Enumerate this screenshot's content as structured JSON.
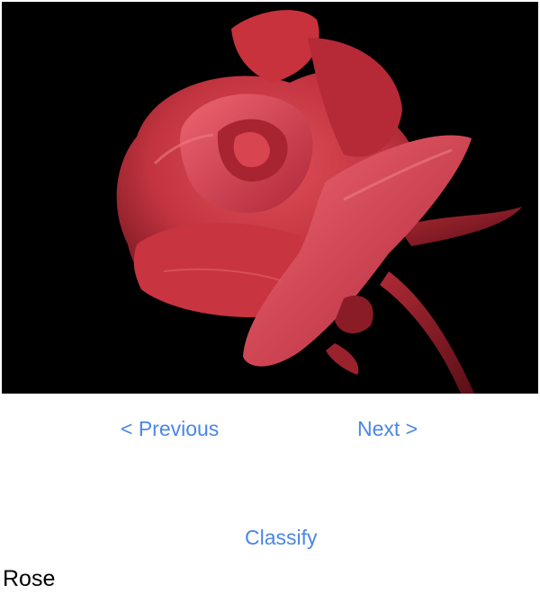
{
  "colors": {
    "accent": "#4a86e8",
    "background": "#ffffff",
    "photo_background": "#000000",
    "rose_red": "#c8323c"
  },
  "image": {
    "subject_icon": "rose-photo"
  },
  "navigation": {
    "previous_label": "< Previous",
    "next_label": "Next >"
  },
  "actions": {
    "classify_label": "Classify"
  },
  "result": {
    "label": "Rose"
  }
}
